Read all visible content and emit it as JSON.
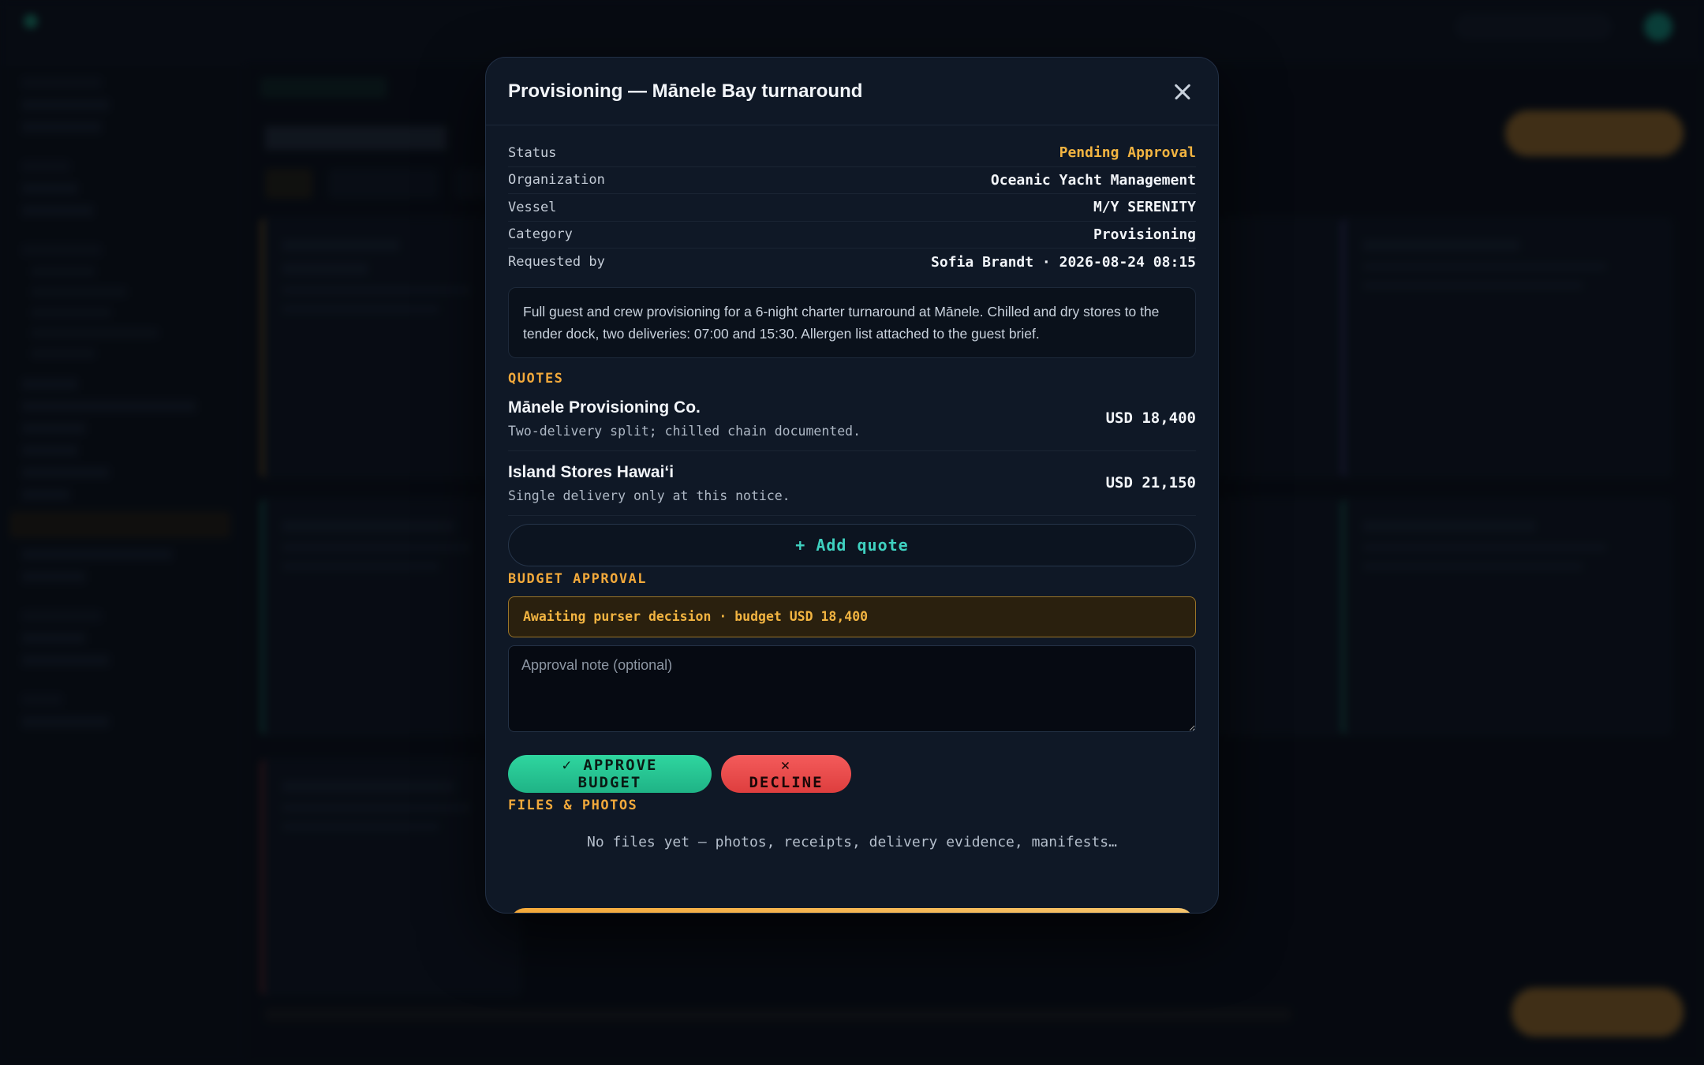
{
  "modal": {
    "title": "Provisioning — Mānele Bay turnaround",
    "details": [
      {
        "key": "Status",
        "value": "Pending Approval"
      },
      {
        "key": "Organization",
        "value": "Oceanic Yacht Management"
      },
      {
        "key": "Vessel",
        "value": "M/Y SERENITY"
      },
      {
        "key": "Category",
        "value": "Provisioning"
      },
      {
        "key": "Requested by",
        "value": "Sofia Brandt · 2026-08-24 08:15"
      }
    ],
    "description": "Full guest and crew provisioning for a 6-night charter turnaround at Mānele. Chilled and dry stores to the tender dock, two deliveries: 07:00 and 15:30. Allergen list attached to the guest brief.",
    "quotes_label": "QUOTES",
    "quotes": [
      {
        "vendor": "Mānele Provisioning Co.",
        "note": "Two-delivery split; chilled chain documented.",
        "amount": "USD 18,400"
      },
      {
        "vendor": "Island Stores Hawaiʻi",
        "note": "Single delivery only at this notice.",
        "amount": "USD 21,150"
      }
    ],
    "add_quote_label": "+ Add quote",
    "budget_label": "BUDGET APPROVAL",
    "budget_alert": "Awaiting purser decision · budget USD 18,400",
    "note_placeholder": "Approval note (optional)",
    "approve_label": "✓ APPROVE BUDGET",
    "decline_label": "✕ DECLINE",
    "files_label": "FILES & PHOTOS",
    "files_empty": "No files yet — photos, receipts, delivery evidence, manifests…"
  },
  "colors": {
    "accent_amber": "#f2a93b",
    "approve_green": "#2fd69f",
    "decline_red": "#f45b5b",
    "teal": "#3fd1c0",
    "modal_bg": "#0f1826"
  },
  "icons": {
    "close": "close-icon"
  }
}
